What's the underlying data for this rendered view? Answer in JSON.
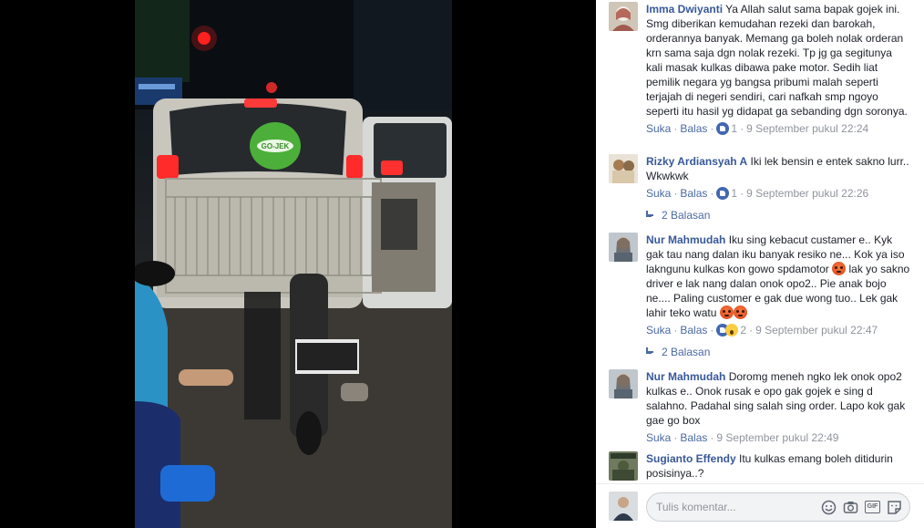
{
  "comments": [
    {
      "author": "Imma Dwiyanti",
      "text": "Ya Allah salut sama bapak gojek ini. Smg diberikan kemudahan rezeki dan barokah, orderannya banyak. Memang ga boleh nolak orderan krn sama saja dgn nolak rezeki. Tp jg ga segitunya kali masak kulkas dibawa pake motor. Sedih liat pemilik negara yg bangsa pribumi malah seperti terjajah di negeri sendiri, cari nafkah smp ngoyo seperti itu hasil yg didapat ga sebanding dgn soronya.",
      "like": "Suka",
      "reply": "Balas",
      "reactions": "1",
      "time": "9 September pukul 22:24"
    },
    {
      "author": "Rizky Ardiansyah A",
      "text": "Iki lek bensin e entek sakno lurr.. Wkwkwk",
      "like": "Suka",
      "reply": "Balas",
      "reactions": "1",
      "time": "9 September pukul 22:26",
      "replies": "2 Balasan"
    },
    {
      "author": "Nur Mahmudah",
      "text_a": "Iku sing kebacut custamer e.. Kyk gak tau nang dalan iku banyak resiko ne... Kok ya iso lakngunu kulkas kon gowo spdamotor",
      "text_b": "lak yo sakno driver e lak nang dalan onok opo2.. Pie anak bojo ne.... Paling customer e gak due wong tuo.. Lek gak lahir teko watu",
      "like": "Suka",
      "reply": "Balas",
      "reactions": "2",
      "time": "9 September pukul 22:47",
      "replies": "2 Balasan"
    },
    {
      "author": "Nur Mahmudah",
      "text": "Doromg meneh ngko lek onok opo2 kulkas e.. Onok rusak e opo gak gojek e sing d salahno. Padahal sing salah sing order. Lapo kok gak gae go box",
      "like": "Suka",
      "reply": "Balas",
      "time": "9 September pukul 22:49"
    },
    {
      "author": "Sugianto Effendy",
      "text": "Itu kulkas emang boleh ditidurin posisinya..?"
    }
  ],
  "composer": {
    "placeholder": "Tulis komentar..."
  },
  "photo": {
    "helmet_text": "GO-JEK"
  },
  "icons": [
    "like-reaction-icon",
    "wow-reaction-icon",
    "angry-emoji-icon",
    "reply-arrow-icon",
    "emoji-icon",
    "camera-icon",
    "gif-icon",
    "sticker-icon"
  ],
  "colors": {
    "link": "#385898",
    "meta": "#90949c",
    "action": "#4b6aa1",
    "like": "#4267b2",
    "helmet": "#4caf3a"
  }
}
